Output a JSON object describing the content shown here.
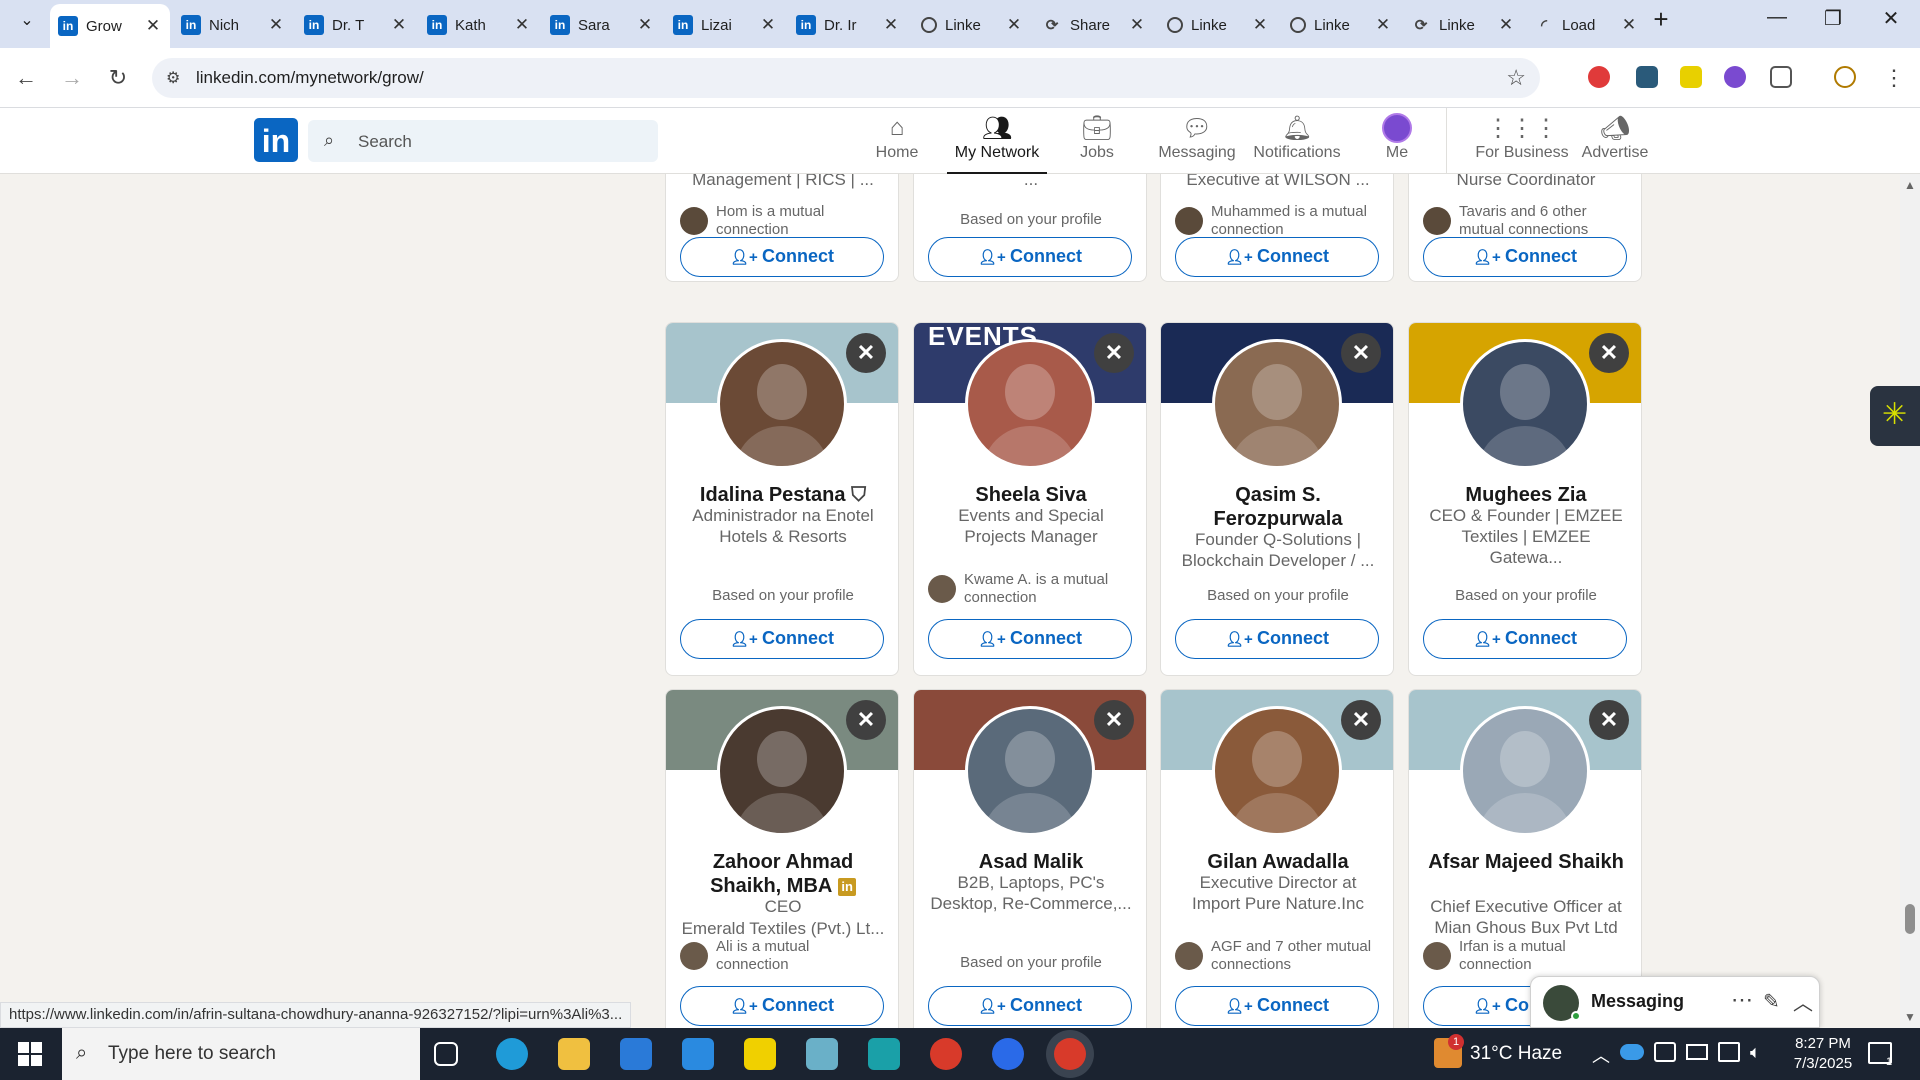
{
  "browser": {
    "tabs": [
      {
        "title": "Grow",
        "icon": "linkedin-icon",
        "active": true
      },
      {
        "title": "Nich",
        "icon": "linkedin-icon"
      },
      {
        "title": "Dr. T",
        "icon": "linkedin-icon"
      },
      {
        "title": "Kath",
        "icon": "linkedin-icon"
      },
      {
        "title": "Sara",
        "icon": "linkedin-icon"
      },
      {
        "title": "Lizai",
        "icon": "linkedin-icon"
      },
      {
        "title": "Dr. Ir",
        "icon": "linkedin-icon"
      },
      {
        "title": "Linke",
        "icon": "ring-icon"
      },
      {
        "title": "Share",
        "icon": "share-icon"
      },
      {
        "title": "Linke",
        "icon": "ring-icon"
      },
      {
        "title": "Linke",
        "icon": "ring-icon"
      },
      {
        "title": "Linke",
        "icon": "share-icon"
      },
      {
        "title": "Load",
        "icon": "loading-icon"
      }
    ],
    "url": "linkedin.com/mynetwork/grow/",
    "hover_url": "https://www.linkedin.com/in/afrin-sultana-chowdhury-ananna-926327152/?lipi=urn%3Ali%3..."
  },
  "linkedin": {
    "logo": "in",
    "search_placeholder": "Search",
    "nav": [
      {
        "label": "Home",
        "icon": "home-icon"
      },
      {
        "label": "My Network",
        "icon": "network-icon",
        "active": true
      },
      {
        "label": "Jobs",
        "icon": "briefcase-icon"
      },
      {
        "label": "Messaging",
        "icon": "chat-icon"
      },
      {
        "label": "Notifications",
        "icon": "bell-icon"
      },
      {
        "label": "Me",
        "icon": "avatar-icon"
      },
      {
        "label": "For Business",
        "icon": "grid-icon"
      },
      {
        "label": "Advertise",
        "icon": "advertise-icon"
      }
    ]
  },
  "top_row": [
    {
      "headline_tail": "Management | RICS | ...",
      "mutual": "Hom is a mutual connection",
      "connect": "Connect"
    },
    {
      "headline_tail": "...",
      "based": "Based on your profile",
      "connect": "Connect"
    },
    {
      "headline_tail": "Executive at WILSON ...",
      "mutual": "Muhammed is a mutual connection",
      "connect": "Connect"
    },
    {
      "headline_tail": "Nurse Coordinator",
      "mutual": "Tavaris and 6 other mutual connections",
      "connect": "Connect"
    }
  ],
  "row2": [
    {
      "name": "Idalina Pestana",
      "badge": "verified-icon",
      "headline": "Administrador na Enotel Hotels & Resorts",
      "based": "Based on your profile",
      "connect": "Connect",
      "banner_color": "#a7c4cc",
      "avatar_color": "#6b4a36"
    },
    {
      "name": "Sheela Siva",
      "headline": "Events and Special Projects Manager",
      "mutual": "Kwame A. is a mutual connection",
      "banner_text": "EVENTS",
      "connect": "Connect",
      "banner_color": "#2e3b6b",
      "avatar_color": "#a85a4a"
    },
    {
      "name": "Qasim S. Ferozpurwala",
      "headline": "Founder Q-Solutions | Blockchain Developer / ...",
      "based": "Based on your profile",
      "connect": "Connect",
      "banner_color": "#1a2a55",
      "avatar_color": "#8a6a52"
    },
    {
      "name": "Mughees Zia",
      "headline": "CEO & Founder | EMZEE Textiles | EMZEE Gatewa...",
      "based": "Based on your profile",
      "connect": "Connect",
      "banner_color": "#d6a400",
      "avatar_color": "#3b4a62"
    }
  ],
  "row3": [
    {
      "name": "Zahoor Ahmad Shaikh, MBA",
      "badge": "linkedin-badge-icon",
      "headline": "CEO",
      "headline2": "Emerald Textiles (Pvt.) Lt...",
      "mutual": "Ali is a mutual connection",
      "connect": "Connect",
      "banner_color": "#7a8a80",
      "avatar_color": "#4a3a30"
    },
    {
      "name": "Asad Malik",
      "headline": "B2B, Laptops, PC's Desktop, Re-Commerce,...",
      "based": "Based on your profile",
      "connect": "Connect",
      "banner_color": "#8a4a3a",
      "avatar_color": "#5a6a7a"
    },
    {
      "name": "Gilan Awadalla",
      "headline": "Executive Director at Import Pure Nature.Inc",
      "mutual": "AGF and 7 other mutual connections",
      "connect": "Connect",
      "banner_color": "#a7c4cc",
      "avatar_color": "#8a5a3a"
    },
    {
      "name": "Afsar Majeed Shaikh",
      "headline": "Chief Executive Officer at Mian Ghous Bux Pvt Ltd",
      "mutual": "Irfan is a mutual connection",
      "connect": "Connect",
      "banner_color": "#a7c4cc",
      "avatar_color": "#9aa8b6"
    }
  ],
  "messaging": {
    "label": "Messaging"
  },
  "taskbar": {
    "search_placeholder": "Type here to search",
    "weather": "31°C Haze",
    "time": "8:27 PM",
    "date": "7/3/2025",
    "notif_count": "1"
  }
}
